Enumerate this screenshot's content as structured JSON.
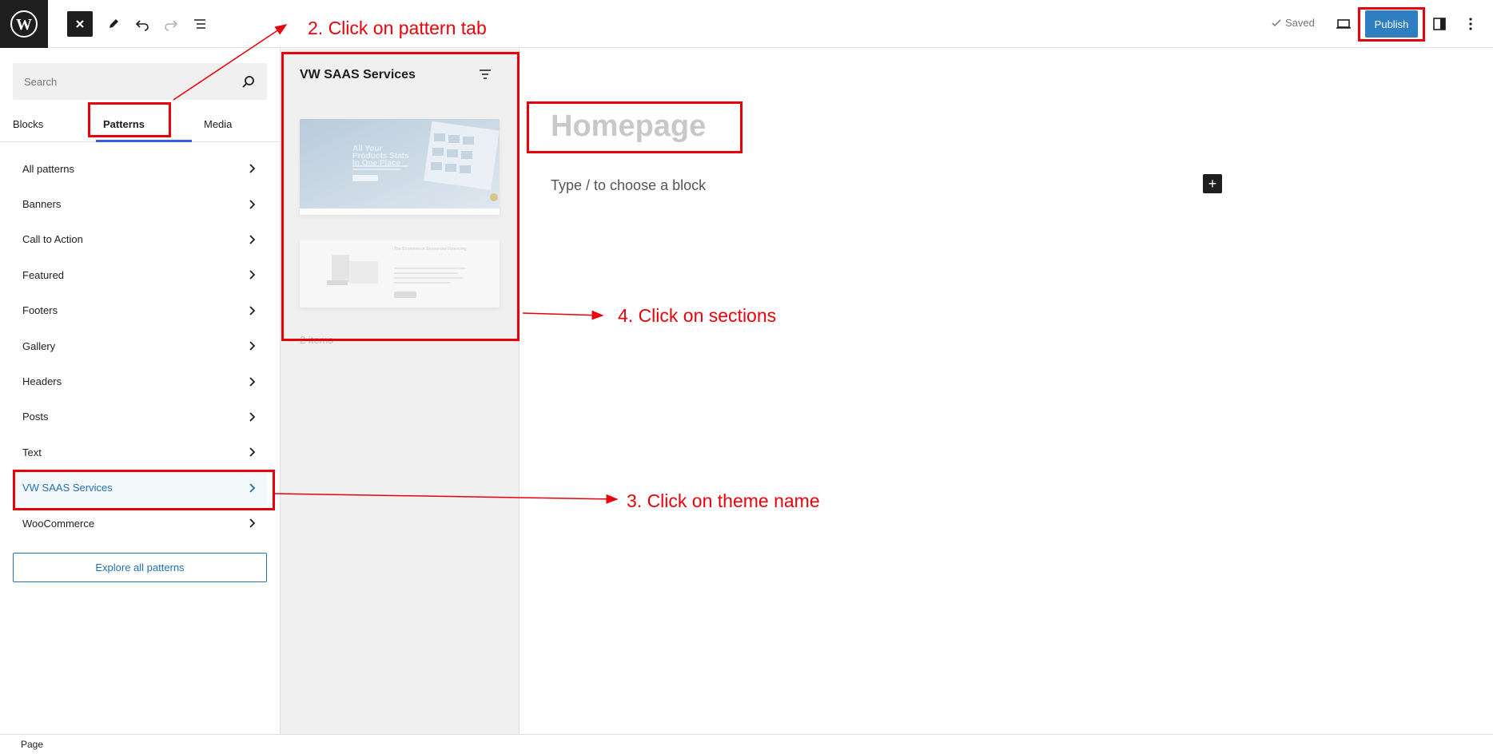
{
  "topbar": {
    "saved_label": "Saved",
    "publish_label": "Publish"
  },
  "sidebar": {
    "search_placeholder": "Search",
    "tabs": [
      "Blocks",
      "Patterns",
      "Media"
    ],
    "active_tab": "Patterns",
    "categories": [
      "All patterns",
      "Banners",
      "Call to Action",
      "Featured",
      "Footers",
      "Gallery",
      "Headers",
      "Posts",
      "Text",
      "VW SAAS Services",
      "WooCommerce"
    ],
    "selected_category": "VW SAAS Services",
    "explore_label": "Explore all patterns"
  },
  "pattern_panel": {
    "title": "VW SAAS Services",
    "count_label": "2 items",
    "preview1": {
      "heading": "All Your Products Stats In One Place"
    },
    "preview2": {
      "heading": "The Ecommerce Resources Financing"
    }
  },
  "canvas": {
    "page_title": "Homepage",
    "block_hint": "Type / to choose a block"
  },
  "footer": {
    "breadcrumb": "Page"
  },
  "annotations": {
    "step2": "2. Click on pattern tab",
    "step3": "3. Click on theme name",
    "step4": "4. Click on sections"
  },
  "colors": {
    "accent": "#3858e9",
    "publish": "#2e7ec0",
    "annotation": "#e8000b",
    "link": "#2271b1"
  }
}
